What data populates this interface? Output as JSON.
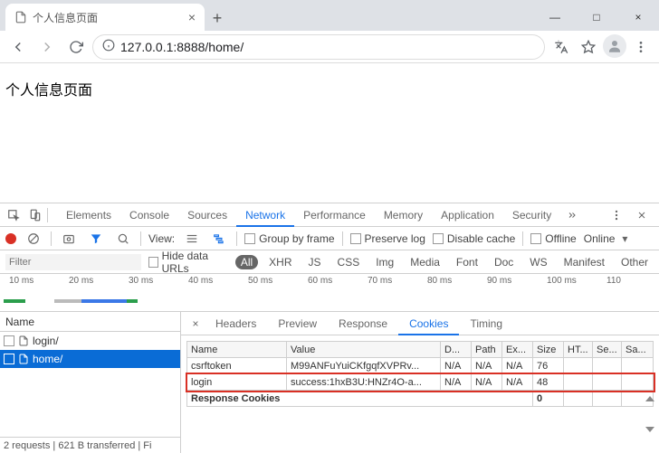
{
  "browser": {
    "tab_title": "个人信息页面",
    "newtab_glyph": "+",
    "close_glyph": "×",
    "url": "127.0.0.1:8888/home/",
    "win": {
      "min": "—",
      "max": "□",
      "close": "×"
    }
  },
  "page": {
    "heading": "个人信息页面"
  },
  "devtools": {
    "tabs": [
      "Elements",
      "Console",
      "Sources",
      "Network",
      "Performance",
      "Memory",
      "Application",
      "Security"
    ],
    "active_tab": "Network",
    "toolbar": {
      "view_label": "View:",
      "group_by_frame": "Group by frame",
      "preserve_log": "Preserve log",
      "disable_cache": "Disable cache",
      "offline": "Offline",
      "online": "Online"
    },
    "filter": {
      "placeholder": "Filter",
      "hide_data_urls": "Hide data URLs",
      "types": [
        "All",
        "XHR",
        "JS",
        "CSS",
        "Img",
        "Media",
        "Font",
        "Doc",
        "WS",
        "Manifest",
        "Other"
      ],
      "active_type": "All"
    },
    "timeline": {
      "ticks": [
        "10 ms",
        "20 ms",
        "30 ms",
        "40 ms",
        "50 ms",
        "60 ms",
        "70 ms",
        "80 ms",
        "90 ms",
        "100 ms",
        "110"
      ]
    },
    "requests": {
      "header": "Name",
      "items": [
        "login/",
        "home/"
      ],
      "selected": "home/",
      "footer": "2 requests | 621 B transferred | Fi"
    },
    "detail": {
      "tabs": [
        "Headers",
        "Preview",
        "Response",
        "Cookies",
        "Timing"
      ],
      "active": "Cookies",
      "cookies": {
        "columns": [
          "Name",
          "Value",
          "D...",
          "Path",
          "Ex...",
          "Size",
          "HT...",
          "Se...",
          "Sa..."
        ],
        "rows": [
          {
            "name": "csrftoken",
            "value": "M99ANFuYuiCKfgqfXVPRv...",
            "d": "N/A",
            "path": "N/A",
            "ex": "N/A",
            "size": "76",
            "ht": "",
            "se": "",
            "sa": ""
          },
          {
            "name": "login",
            "value": "success:1hxB3U:HNZr4O-a...",
            "d": "N/A",
            "path": "N/A",
            "ex": "N/A",
            "size": "48",
            "ht": "",
            "se": "",
            "sa": ""
          }
        ],
        "section": "Response Cookies",
        "section_size": "0"
      }
    }
  }
}
